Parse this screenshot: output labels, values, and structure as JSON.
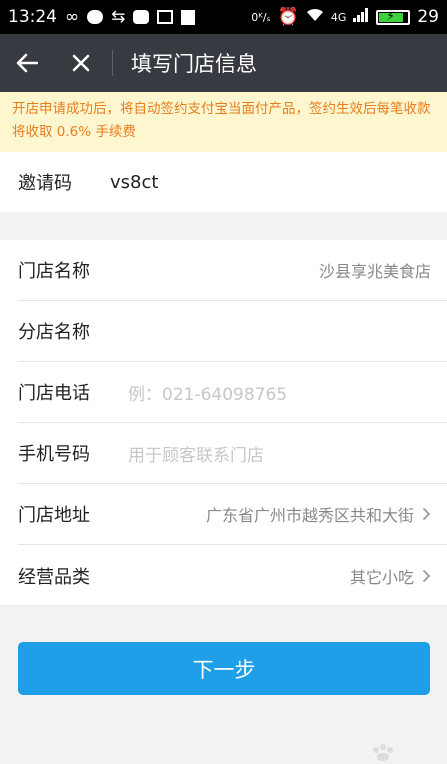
{
  "status_bar": {
    "time": "13:24",
    "speed": "0ᴷ/ₛ",
    "network": "4G",
    "battery": "29"
  },
  "header": {
    "title": "填写门店信息"
  },
  "notice": {
    "text": "开店申请成功后，将自动签约支付宝当面付产品，签约生效后每笔收款将收取 0.6% 手续费"
  },
  "invite": {
    "label": "邀请码",
    "value": "vs8ct"
  },
  "form": {
    "store_name": {
      "label": "门店名称",
      "value": "沙县享兆美食店"
    },
    "branch_name": {
      "label": "分店名称",
      "value": ""
    },
    "store_phone": {
      "label": "门店电话",
      "placeholder": "例：021-64098765"
    },
    "mobile": {
      "label": "手机号码",
      "placeholder": "用于顾客联系门店"
    },
    "address": {
      "label": "门店地址",
      "value": "广东省广州市越秀区共和大街"
    },
    "category": {
      "label": "经营品类",
      "value": "其它小吃"
    }
  },
  "actions": {
    "next_label": "下一步"
  },
  "colors": {
    "accent": "#1e9fe7",
    "nav_bg": "#373a41",
    "notice_bg": "#fef6cf",
    "notice_text": "#e67e1f"
  }
}
